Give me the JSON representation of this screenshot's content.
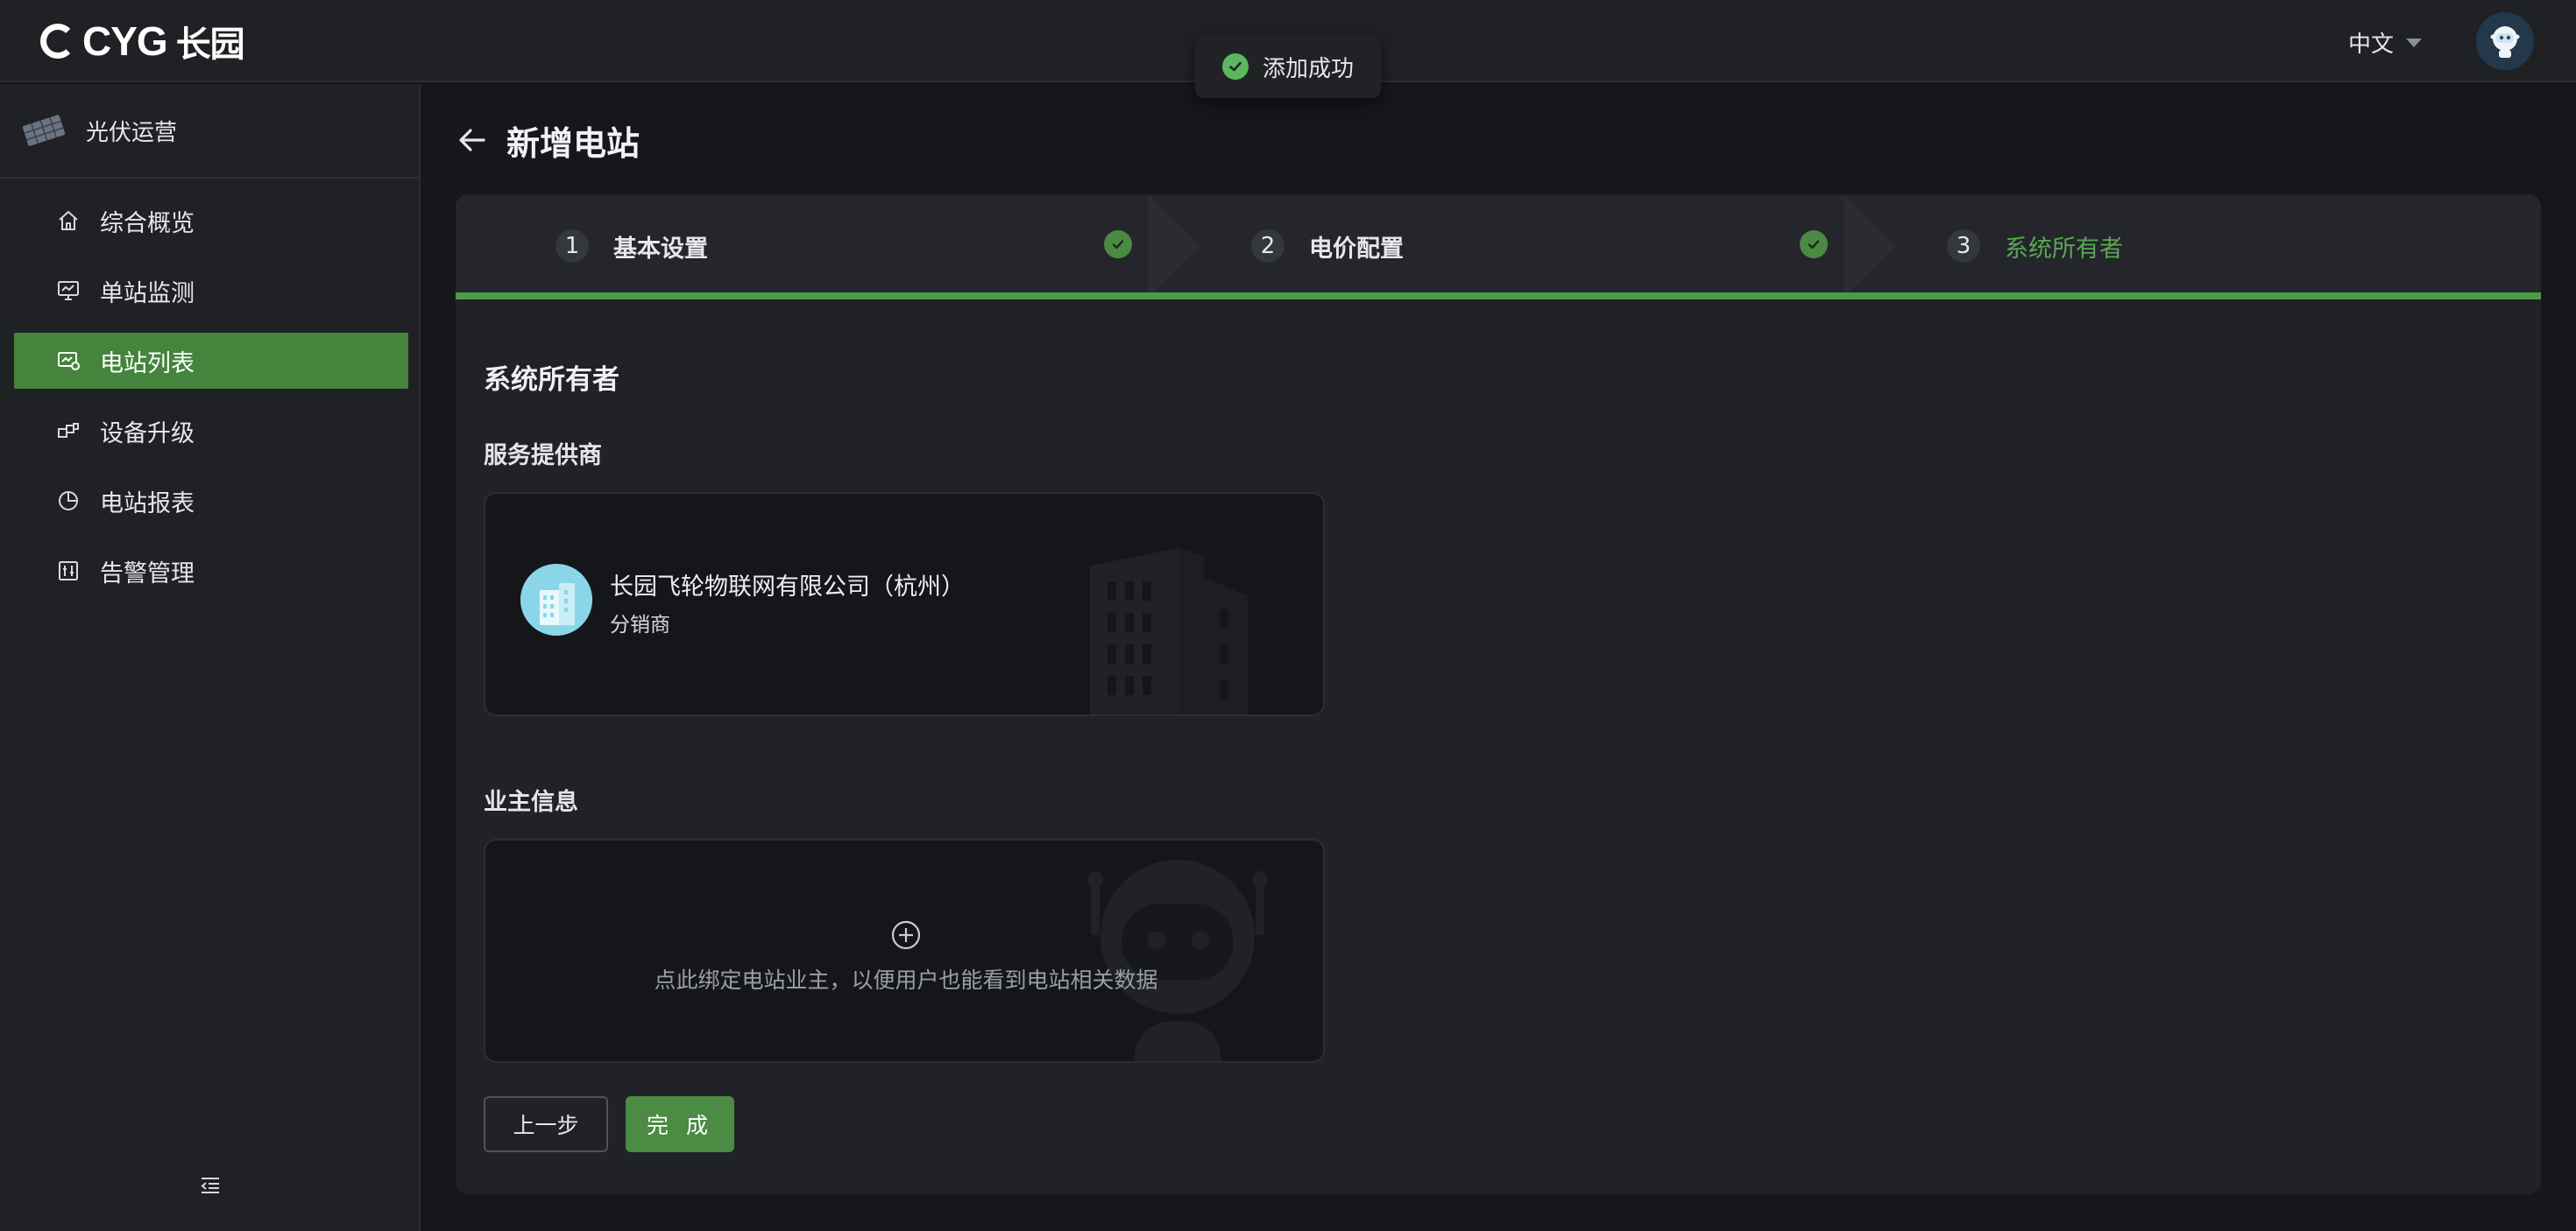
{
  "header": {
    "logo_text": "CYG",
    "logo_cn": "长园",
    "language": "中文"
  },
  "toast": {
    "message": "添加成功",
    "icon": "check-circle-icon"
  },
  "sidebar": {
    "app_name": "光伏运营",
    "items": [
      {
        "label": "综合概览",
        "icon": "home-icon"
      },
      {
        "label": "单站监测",
        "icon": "monitor-icon"
      },
      {
        "label": "电站列表",
        "icon": "station-list-icon",
        "active": true
      },
      {
        "label": "设备升级",
        "icon": "device-upgrade-icon"
      },
      {
        "label": "电站报表",
        "icon": "pie-report-icon"
      },
      {
        "label": "告警管理",
        "icon": "alarm-sliders-icon"
      }
    ]
  },
  "page": {
    "title": "新增电站"
  },
  "steps": [
    {
      "number": "1",
      "label": "基本设置",
      "status": "done"
    },
    {
      "number": "2",
      "label": "电价配置",
      "status": "done"
    },
    {
      "number": "3",
      "label": "系统所有者",
      "status": "current"
    }
  ],
  "form": {
    "section_title": "系统所有者",
    "provider_label": "服务提供商",
    "provider": {
      "name": "长园飞轮物联网有限公司（杭州）",
      "type": "分销商"
    },
    "owner_label": "业主信息",
    "owner_hint": "点此绑定电站业主，以便用户也能看到电站相关数据"
  },
  "buttons": {
    "prev": "上一步",
    "done": "完 成"
  },
  "colors": {
    "accent": "#44843c",
    "step_current": "#5aa653",
    "toast_ok": "#5cb85c",
    "background": "#15171b"
  }
}
